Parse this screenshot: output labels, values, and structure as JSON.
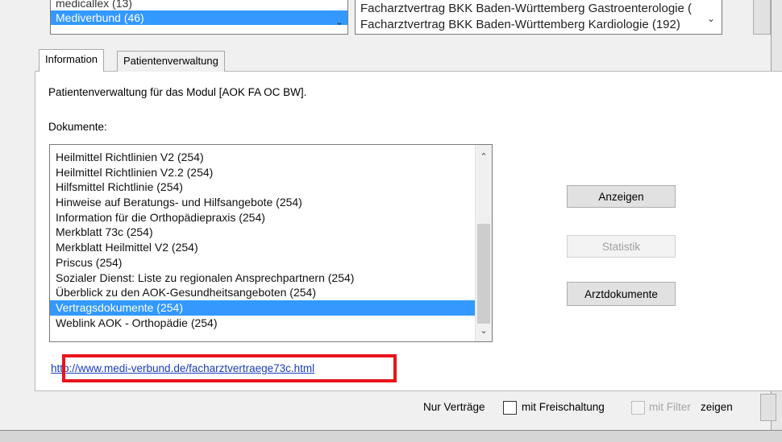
{
  "top_list_left": {
    "items": [
      "medicallex (13)",
      "Mediverbund (46)"
    ],
    "selected_index": 1
  },
  "top_list_right": {
    "items": [
      "Facharztvertrag BKK Baden-Württemberg Gastroenterologie (",
      "Facharztvertrag BKK Baden-Württemberg Kardiologie (192)"
    ]
  },
  "tabs": [
    {
      "label": "Information",
      "active": true
    },
    {
      "label": "Patientenverwaltung",
      "active": false
    }
  ],
  "info": {
    "description": "Patientenverwaltung für das Modul [AOK FA OC BW].",
    "documents_label": "Dokumente:"
  },
  "documents": {
    "items": [
      "Heilmittel Richtlinien V2 (254)",
      "Heilmittel Richtlinien V2.2 (254)",
      "Hilfsmittel Richtlinie (254)",
      "Hinweise auf Beratungs- und Hilfsangebote (254)",
      "Information für die Orthopädiepraxis (254)",
      "Merkblatt 73c (254)",
      "Merkblatt Heilmittel V2 (254)",
      "Priscus (254)",
      "Sozialer Dienst: Liste zu regionalen Ansprechpartnern (254)",
      "Überblick zu den AOK-Gesundheitsangeboten (254)",
      "Vertragsdokumente (254)",
      "Weblink AOK - Orthopädie (254)"
    ],
    "selected_index": 10
  },
  "buttons": {
    "show": "Anzeigen",
    "statistics": "Statistik",
    "doctor_documents": "Arztdokumente"
  },
  "link": {
    "url_text": "http://www.medi-verbund.de/facharztvertraege73c.html"
  },
  "bottom_bar": {
    "contracts_only": "Nur Verträge",
    "with_activation": "mit Freischaltung",
    "with_filter": "mit Filter",
    "show": "zeigen"
  },
  "colors": {
    "selection": "#3399ff",
    "highlight_box": "#e8141b",
    "link": "#1a3cbf"
  }
}
